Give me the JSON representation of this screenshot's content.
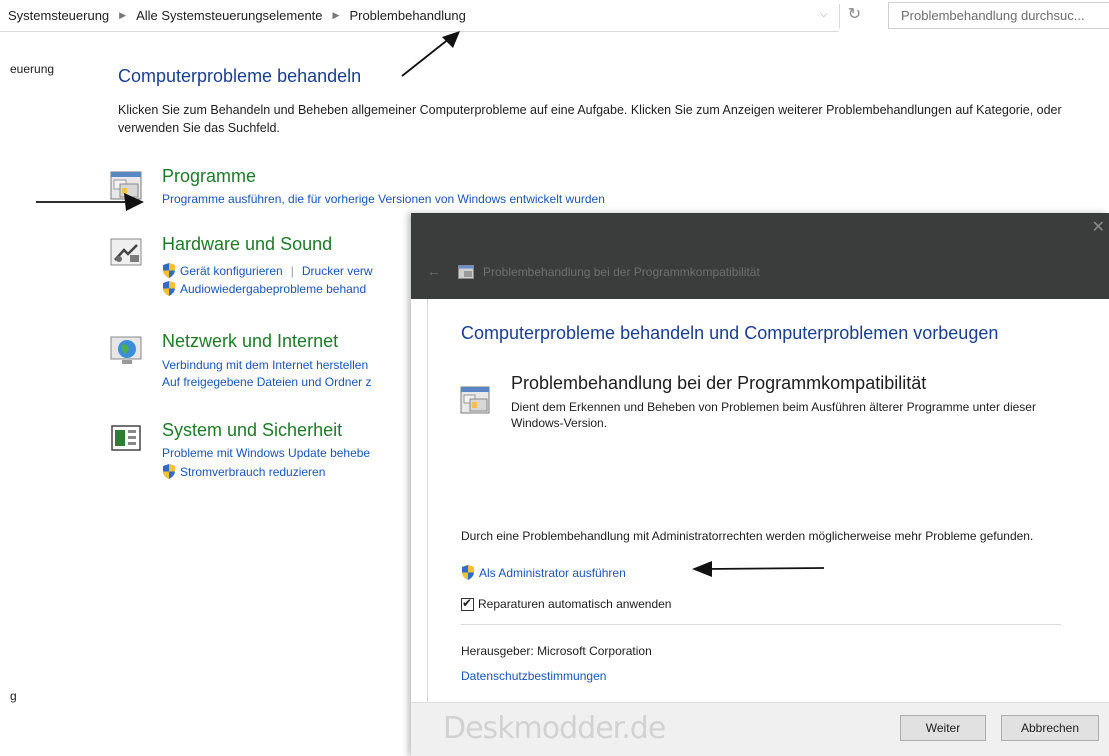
{
  "address_bar": {
    "breadcrumbs": [
      "Systemsteuerung",
      "Alle Systemsteuerungselemente",
      "Problembehandlung"
    ],
    "search_placeholder": "Problembehandlung durchsuc..."
  },
  "left_nav": {
    "fragment_top": "euerung",
    "fragment_bottom": "g"
  },
  "main": {
    "title": "Computerprobleme behandeln",
    "description": "Klicken Sie zum Behandeln und Beheben allgemeiner Computerprobleme auf eine Aufgabe. Klicken Sie zum Anzeigen weiterer Problembehandlungen auf Kategorie, oder verwenden Sie das Suchfeld.",
    "categories": [
      {
        "title": "Programme",
        "icon": "programs-icon",
        "links": [
          "Programme ausführen, die für vorherige Versionen von Windows entwickelt wurden"
        ]
      },
      {
        "title": "Hardware und Sound",
        "icon": "hardware-sound-icon",
        "links": [
          "Gerät konfigurieren",
          "Drucker verw",
          "Audiowiedergabeprobleme behand"
        ]
      },
      {
        "title": "Netzwerk und Internet",
        "icon": "network-globe-icon",
        "links": [
          "Verbindung mit dem Internet herstellen",
          "Auf freigegebene Dateien und Ordner z"
        ]
      },
      {
        "title": "System und Sicherheit",
        "icon": "system-security-icon",
        "links": [
          "Probleme mit Windows Update behebe",
          "Stromverbrauch reduzieren"
        ]
      }
    ]
  },
  "dialog": {
    "window_title": "Problembehandlung bei der Programmkompatibilität",
    "close_glyph": "✕",
    "back_glyph": "←",
    "heading": "Computerprobleme behandeln und Computerproblemen vorbeugen",
    "item": {
      "title": "Problembehandlung bei der Programmkompatibilität",
      "description": "Dient dem Erkennen und Beheben von Problemen beim Ausführen älterer Programme unter dieser Windows-Version."
    },
    "admin_note": "Durch eine Problembehandlung mit Administratorrechten werden möglicherweise mehr Probleme gefunden.",
    "admin_link": "Als Administrator ausführen",
    "auto_repair_label": "Reparaturen automatisch anwenden",
    "auto_repair_checked": true,
    "publisher_label": "Herausgeber:",
    "publisher_value": "Microsoft Corporation",
    "privacy_link": "Datenschutzbestimmungen",
    "watermark": "Deskmodder.de",
    "buttons": {
      "next": "Weiter",
      "cancel": "Abbrechen"
    }
  },
  "colors": {
    "link_blue": "#1a55b5",
    "category_green": "#1e7a28",
    "heading_blue": "#1a3f8f",
    "titlebar_dark": "#3b3d3c"
  }
}
